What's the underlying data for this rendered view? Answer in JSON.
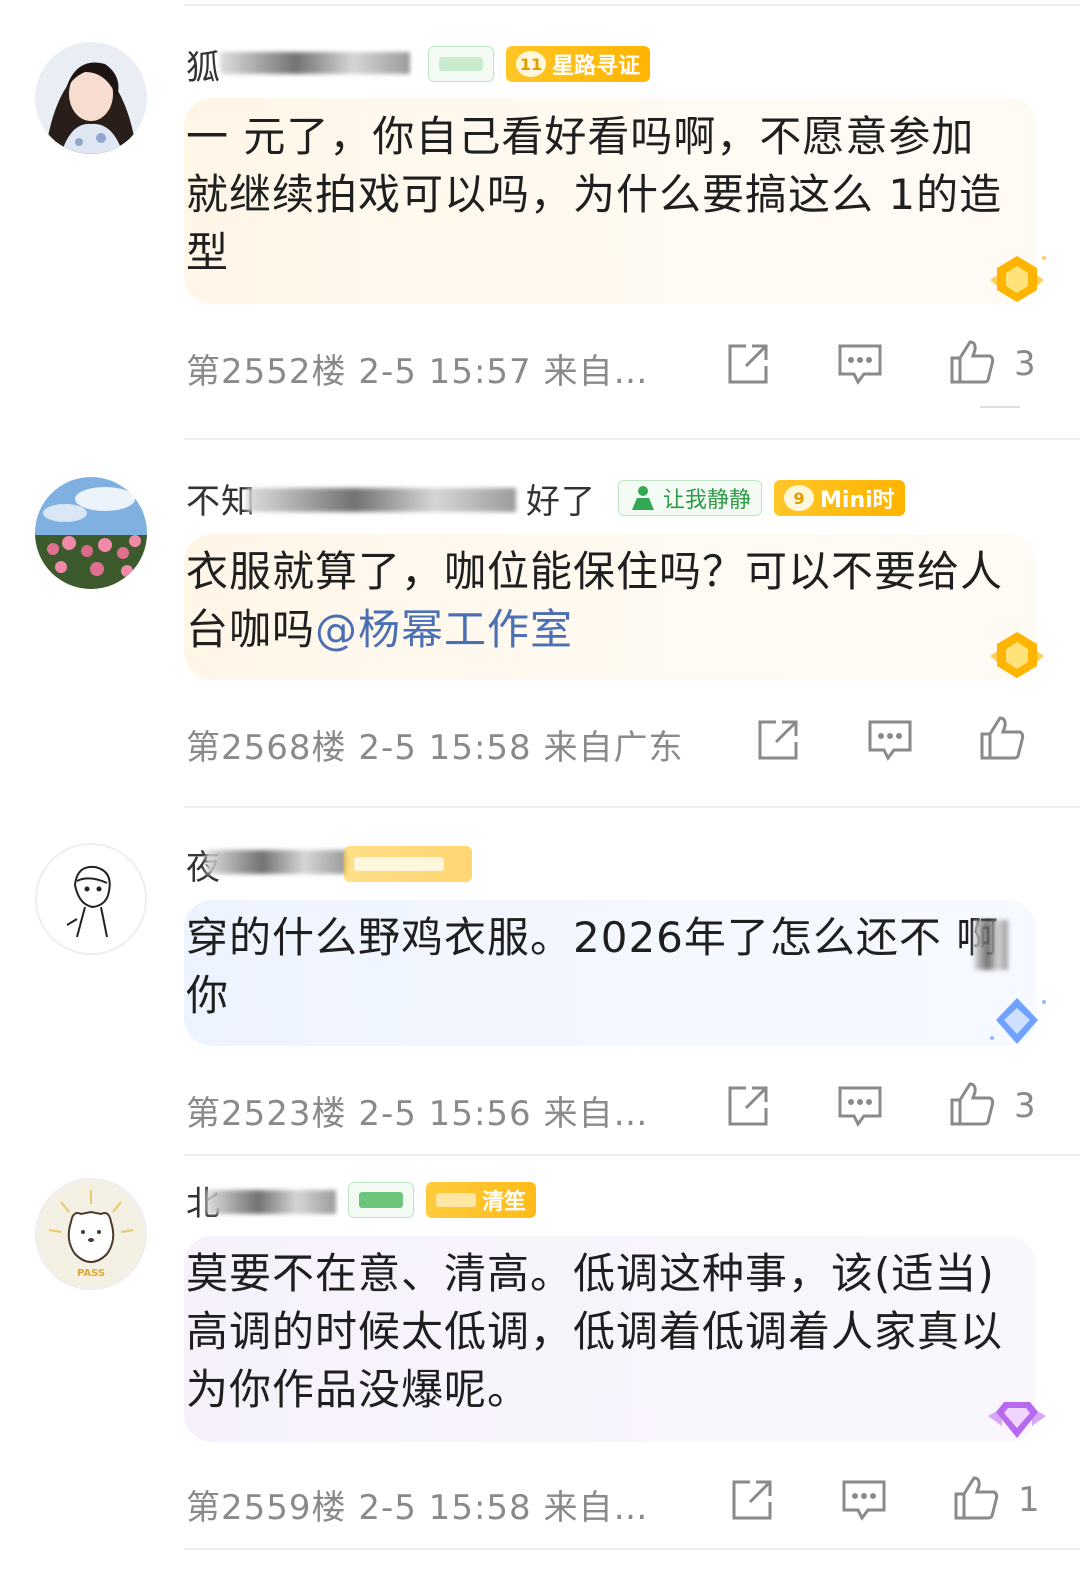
{
  "comments": [
    {
      "username": "狐",
      "badges": [
        {
          "icon": "",
          "text": ""
        },
        {
          "icon": "11",
          "text": "星路寻证"
        }
      ],
      "text": "一 元了，你自己看好看吗啊，不愿意参加就继续拍戏可以吗，为什么要搞这么 1的造型",
      "floor": "第2552楼",
      "time": "2-5 15:57",
      "source": "来自…",
      "likes": "3",
      "bubble": "gold"
    },
    {
      "username": "不知",
      "username_tail": "好了",
      "badges": [
        {
          "icon": "person",
          "text": "让我静静"
        },
        {
          "icon": "9",
          "text": "Mini时"
        }
      ],
      "text_main": "衣服就算了，咖位能保住吗？可以不要给人台咖吗",
      "mention": "@杨幂工作室",
      "floor": "第2568楼",
      "time": "2-5 15:58",
      "source": "来自广东",
      "likes": "",
      "bubble": "gold"
    },
    {
      "username": "夜",
      "badges": [
        {
          "icon": "",
          "text": ""
        }
      ],
      "text": "穿的什么野鸡衣服。2026年了怎么还不 啊你",
      "floor": "第2523楼",
      "time": "2-5 15:56",
      "source": "来自…",
      "likes": "3",
      "bubble": "blue"
    },
    {
      "username": "北",
      "badges": [
        {
          "icon": "",
          "text": ""
        },
        {
          "icon": "",
          "text": "清笙"
        }
      ],
      "text": "莫要不在意、清高。低调这种事，该(适当)高调的时候太低调，低调着低调着人家真以为你作品没爆呢。",
      "floor": "第2559楼",
      "time": "2-5 15:58",
      "source": "来自…",
      "likes": "1",
      "bubble": "purple"
    }
  ],
  "icons": {
    "share": "share-icon",
    "reply": "comment-icon",
    "like": "thumbs-up-icon"
  },
  "colors": {
    "meta": "#8a8a8a",
    "mention": "#4a6fb5",
    "badge_gold": "#ffb400",
    "badge_green": "#2e9b47"
  }
}
